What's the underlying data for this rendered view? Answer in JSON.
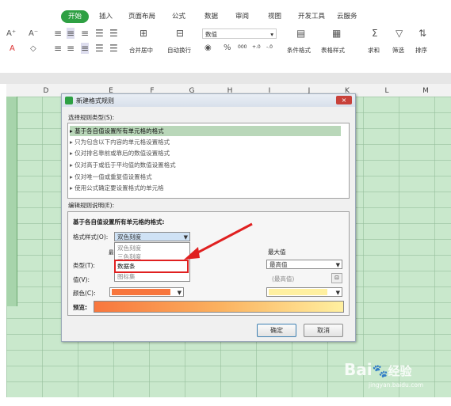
{
  "ribbon": {
    "tabs": [
      "开始",
      "插入",
      "页面布局",
      "公式",
      "数据",
      "审阅",
      "视图",
      "开发工具",
      "云服务"
    ],
    "font_buttons": [
      "A⁺",
      "A⁻",
      "A",
      "◇"
    ],
    "number_format": "数值",
    "number_symbols": [
      "%",
      "000",
      "+.0",
      "-.0"
    ],
    "buttons": {
      "merge_center": "合并居中",
      "wrap_text": "自动换行",
      "conditional_format": "条件格式",
      "table_style": "表格样式",
      "sum": "求和",
      "filter": "筛选",
      "sort": "排序"
    }
  },
  "columns": [
    "D",
    "E",
    "F",
    "G",
    "H",
    "I",
    "J",
    "K",
    "L",
    "M"
  ],
  "dialog": {
    "title": "新建格式规则",
    "rule_type_label": "选择规则类型(S):",
    "rule_types": [
      "基于各自值设置所有单元格的格式",
      "只为包含以下内容的单元格设置格式",
      "仅对排名靠前或靠后的数值设置格式",
      "仅对高于或低于平均值的数值设置格式",
      "仅对唯一值或重复值设置格式",
      "使用公式确定要设置格式的单元格"
    ],
    "edit_label": "编辑规则说明(E):",
    "edit_heading": "基于各自值设置所有单元格的格式:",
    "format_style_label": "格式样式(O):",
    "format_style_value": "双色刻度",
    "dropdown_options": [
      "双色刻度",
      "三色刻度",
      "数据条",
      "图标集"
    ],
    "partial_min_header": "最",
    "type_label": "类型(T):",
    "value_label": "值(V):",
    "color_label": "颜色(C):",
    "max_header": "最大值",
    "max_type": "最高值",
    "max_value_placeholder": "(最高值)",
    "preview_label": "预览:",
    "ok": "确定",
    "cancel": "取消"
  },
  "watermark": {
    "brand": "Bai",
    "suffix": "经验",
    "url": "jingyan.baidu.com"
  },
  "colors": {
    "sheet_green": "#c9e8cc",
    "accent_green": "#2ea043",
    "min_color": "#f8763d",
    "max_color": "#fff0a0",
    "highlight_border": "#e02020",
    "arrow": "#e02020"
  }
}
